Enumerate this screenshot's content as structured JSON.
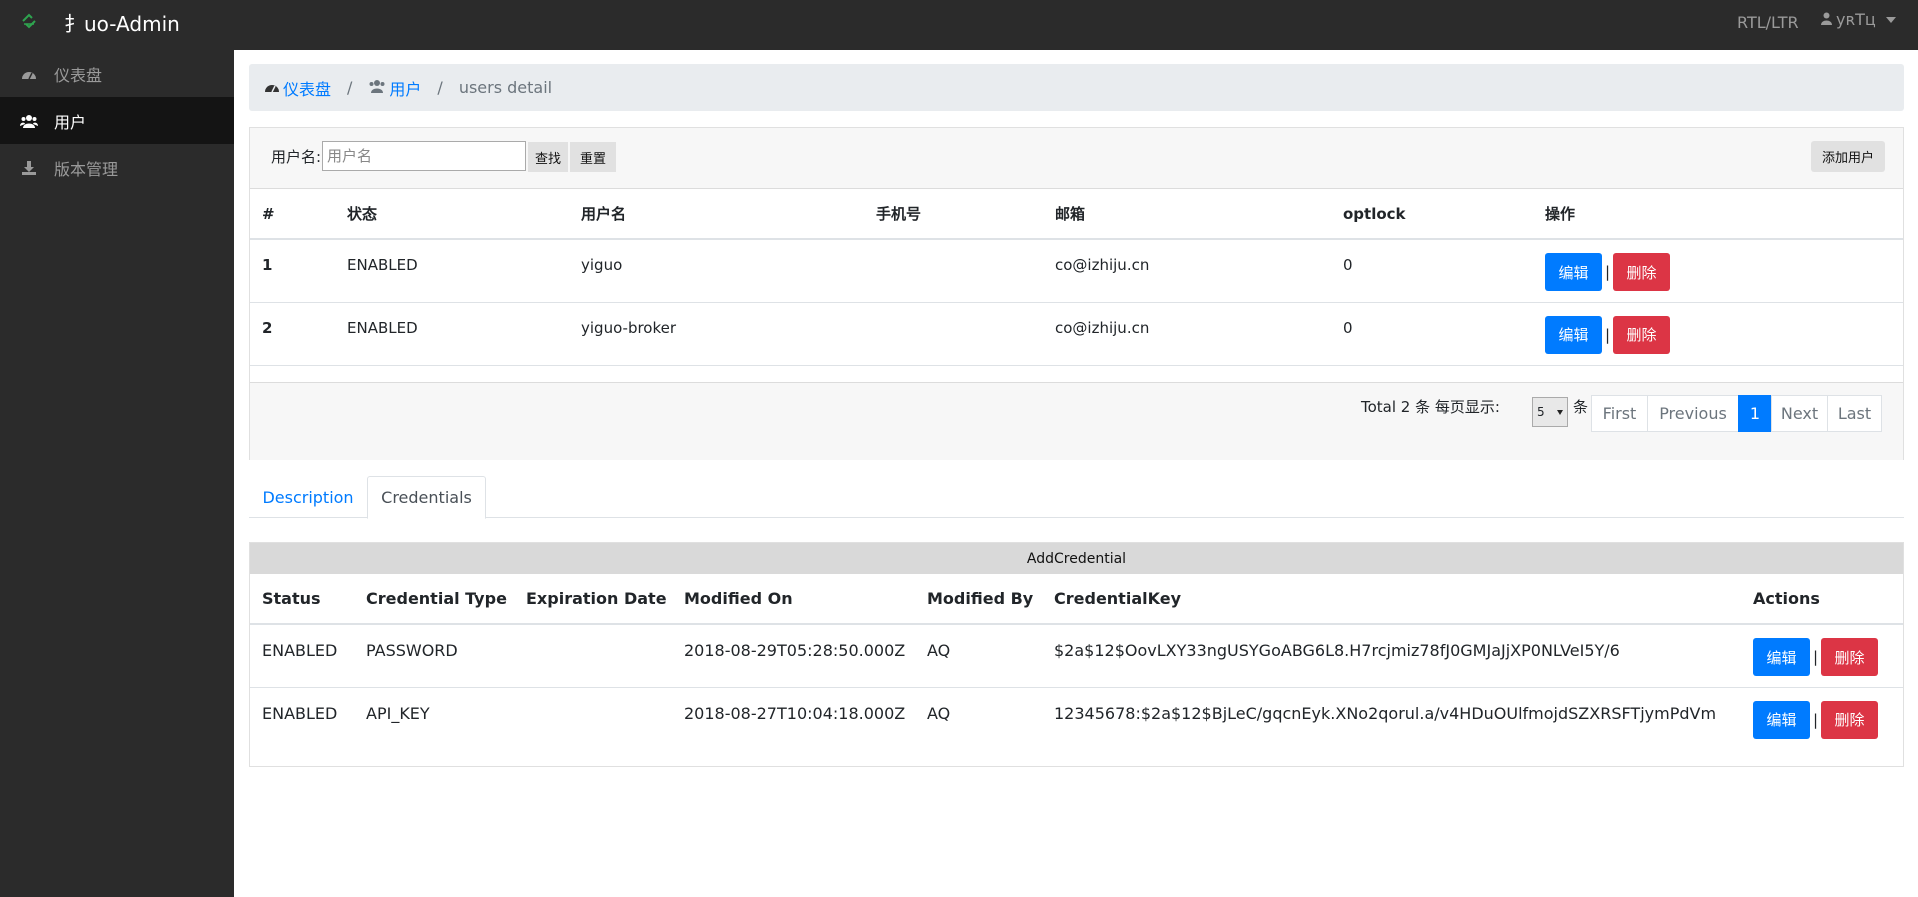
{
  "app": {
    "title": "⺘uo-Admin",
    "rtl_toggle": "RTL/LTR",
    "user_name": "yʀТц"
  },
  "sidebar": {
    "items": [
      {
        "label": "仪表盘",
        "icon": "dashboard-icon"
      },
      {
        "label": "用户",
        "icon": "users-icon"
      },
      {
        "label": "版本管理",
        "icon": "download-icon"
      }
    ]
  },
  "breadcrumb": {
    "home": "仪表盘",
    "users": "用户",
    "current": "users detail"
  },
  "filter": {
    "label": "用户名:",
    "placeholder": "用户名",
    "search_label": "查找",
    "reset_label": "重置",
    "add_user_label": "添加用户"
  },
  "users_table": {
    "headers": [
      "#",
      "状态",
      "用户名",
      "手机号",
      "邮箱",
      "optlock",
      "操作"
    ],
    "rows": [
      {
        "id": "1",
        "status": "ENABLED",
        "username": "yiguo",
        "phone": "",
        "email": "co@izhiju.cn",
        "optlock": "0"
      },
      {
        "id": "2",
        "status": "ENABLED",
        "username": "yiguo-broker",
        "phone": "",
        "email": "co@izhiju.cn",
        "optlock": "0"
      }
    ],
    "edit_label": "编辑",
    "delete_label": "删除",
    "separator": "|"
  },
  "pagination": {
    "total_text": "Total 2 条 每页显示:",
    "page_size": "5",
    "unit": "条",
    "first": "First",
    "previous": "Previous",
    "current_page": "1",
    "next": "Next",
    "last": "Last"
  },
  "tabs": {
    "description": "Description",
    "credentials": "Credentials",
    "active": "Credentials"
  },
  "credentials": {
    "add_label": "AddCredential",
    "headers": [
      "Status",
      "Credential Type",
      "Expiration Date",
      "Modified On",
      "Modified By",
      "CredentialKey",
      "Actions"
    ],
    "rows": [
      {
        "status": "ENABLED",
        "type": "PASSWORD",
        "expiration": "",
        "modified_on": "2018-08-29T05:28:50.000Z",
        "modified_by": "AQ",
        "key": "$2a$12$OovLXY33ngUSYGoABG6L8.H7rcjmiz78fJ0GMJaJjXP0NLVeI5Y/6"
      },
      {
        "status": "ENABLED",
        "type": "API_KEY",
        "expiration": "",
        "modified_on": "2018-08-27T10:04:18.000Z",
        "modified_by": "AQ",
        "key": "12345678:$2a$12$BjLeC/gqcnEyk.XNo2qorul.a/v4HDuOUlfmojdSZXRSFTjymPdVm"
      }
    ],
    "edit_label": "编辑",
    "delete_label": "删除"
  },
  "colors": {
    "topbar": "#2b2b2b",
    "sidebar_active": "#141414",
    "primary": "#007bff",
    "danger": "#dc3545"
  }
}
